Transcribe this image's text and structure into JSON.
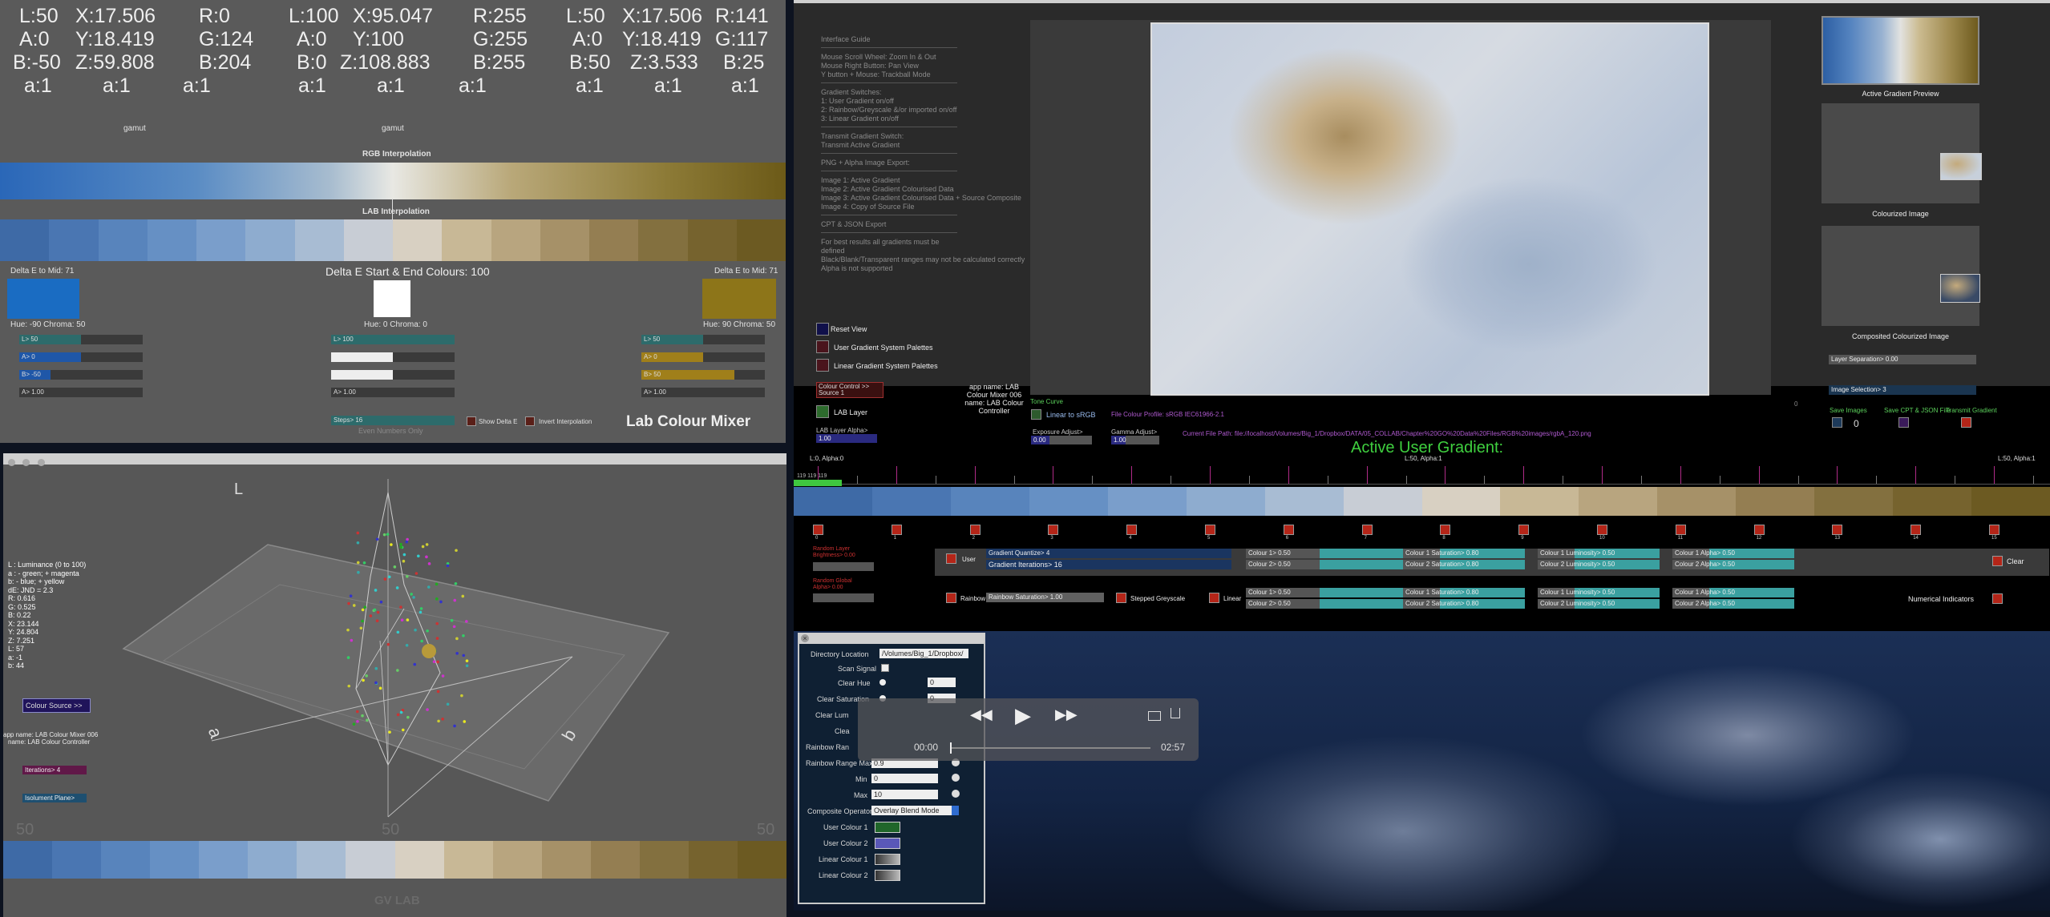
{
  "mixer": {
    "readouts": [
      {
        "rows": [
          [
            "L:50",
            "X:17.506",
            "R:0"
          ],
          [
            "A:0",
            "Y:18.419",
            "G:124"
          ],
          [
            "B:-50",
            "Z:59.808",
            "B:204"
          ],
          [
            "a:1",
            "a:1",
            "a:1"
          ]
        ]
      },
      {
        "rows": [
          [
            "L:100",
            "X:95.047",
            "R:255"
          ],
          [
            "A:0",
            "Y:100",
            "G:255"
          ],
          [
            "B:0",
            "Z:108.883",
            "B:255"
          ],
          [
            "a:1",
            "a:1",
            "a:1"
          ]
        ]
      },
      {
        "rows": [
          [
            "L:50",
            "X:17.506",
            "R:141"
          ],
          [
            "A:0",
            "Y:18.419",
            "G:117"
          ],
          [
            "B:50",
            "Z:3.533",
            "B:25"
          ],
          [
            "a:1",
            "a:1",
            "a:1"
          ]
        ]
      }
    ],
    "gamut_left": "gamut",
    "gamut_mid": "gamut",
    "rgb_label": "RGB Interpolation",
    "lab_label": "LAB Interpolation",
    "delta_left": "Delta E to Mid: 71",
    "delta_title": "Delta E Start & End Colours: 100",
    "delta_right": "Delta E to Mid: 71",
    "hue_left": "Hue: -90 Chroma: 50",
    "hue_mid": "Hue: 0 Chroma: 0",
    "hue_right": "Hue: 90 Chroma: 50",
    "sliders_left": [
      {
        "label": "L> 50",
        "value": 0.5
      },
      {
        "label": "A> 0",
        "value": 0.5
      },
      {
        "label": "B> -50",
        "value": 0.25
      },
      {
        "label": "A> 1.00",
        "value": 1.0
      }
    ],
    "sliders_mid": [
      {
        "label": "L> 100",
        "value": 1.0
      },
      {
        "label": "",
        "value": 0.5
      },
      {
        "label": "",
        "value": 0.5
      },
      {
        "label": "A> 1.00",
        "value": 1.0
      }
    ],
    "sliders_right": [
      {
        "label": "L> 50",
        "value": 0.5
      },
      {
        "label": "A> 0",
        "value": 0.5
      },
      {
        "label": "B> 50",
        "value": 0.75
      },
      {
        "label": "A> 1.00",
        "value": 1.0
      }
    ],
    "steps": "Steps> 16",
    "even_numbers": "Even Numbers Only",
    "show_delta": "Show Delta E",
    "invert_interp": "Invert Interpolation",
    "title": "Lab Colour Mixer",
    "colors": {
      "start": "#007ccc",
      "mid": "#ffffff",
      "end": "#8d7519"
    }
  },
  "gradient16": [
    "#3e6aa6",
    "#4a76b2",
    "#5884bc",
    "#6690c4",
    "#7a9ecb",
    "#8eaccf",
    "#a8bcd3",
    "#c8cdd5",
    "#d8d0c2",
    "#c8b896",
    "#b8a57f",
    "#a69168",
    "#947e52",
    "#83703f",
    "#76632e",
    "#6c5a22"
  ],
  "rgbgrad": [
    "#2a67b8",
    "#5a8cc4",
    "#a7bccf",
    "#e8e8e3",
    "#b9a879",
    "#8c7a36",
    "#6c5a18"
  ],
  "viewer": {
    "info": [
      "L : Luminance (0 to 100)",
      "a : - green; + magenta",
      "b: - blue; + yellow",
      "dE: JND = 2.3",
      "R: 0.616",
      "G: 0.525",
      "B: 0.22",
      "X: 23.144",
      "Y: 24.804",
      "Z: 7.251",
      "L: 57",
      "a: -1",
      "b: 44"
    ],
    "colour_source": "Colour Source >>",
    "app_name": "app name: LAB Colour Mixer 006",
    "app_name2": "name: LAB Colour Controller",
    "axis_l": "L",
    "axis_a": "a",
    "axis_b": "b",
    "slider1": "Iterations> 4",
    "slider2": "Isolument Plane> 0.00",
    "num_left": "50",
    "num_mid": "50",
    "num_right": "50",
    "footer": "GV LAB"
  },
  "guide": {
    "title": "Interface Guide",
    "lines1": [
      "Mouse Scroll Wheel: Zoom In & Out",
      "Mouse Right Button: Pan View",
      "Y button + Mouse: Trackball Mode"
    ],
    "title2": "Gradient Switches:",
    "lines2": [
      "1: User Gradient on/off",
      "2: Rainbow/Greyscale &/or imported on/off",
      "3: Linear Gradient on/off"
    ],
    "title3": "Transmit Gradient Switch:",
    "lines3": [
      "Transmit Active Gradient"
    ],
    "title4": "PNG + Alpha Image Export:",
    "lines4": [
      "Image 1: Active Gradient",
      "Image 2: Active Gradient Colourised Data",
      "Image 3: Active Gradient Colourised Data + Source Composite",
      "Image 4: Copy of Source File"
    ],
    "title5": "CPT & JSON Export",
    "lines5": [
      "For best results all gradients must be defined",
      "Black/Blank/Transparent ranges may not be calculated correctly",
      "Alpha is not supported"
    ]
  },
  "left_controls": {
    "reset": "Reset View",
    "user_palettes": "User Gradient System Palettes",
    "linear_palettes": "Linear Gradient System Palettes",
    "colour_control": "Colour Control >> Source 1",
    "lab_layer": "LAB Layer",
    "lab_alpha": "LAB Layer Alpha>",
    "lab_alpha_val": "1.00",
    "app_name": "app name: LAB Colour Mixer 006",
    "app_name2": "name: LAB Colour Controller",
    "tone_curve": "Tone Curve",
    "linear_srgb": "Linear to sRGB",
    "profile": "File Colour Profile: sRGB IEC61966-2.1",
    "exposure": "Exposure Adjust>",
    "exposure_val": "0.00",
    "gamma": "Gamma Adjust>",
    "gamma_val": "1.00",
    "file_path": "Current File Path: file://localhost/Volumes/Big_1/Dropbox/DATA/05_COLLAB/Chapter%20GO%20Data%20Files/RGB%20images/rgbA_120.png",
    "zero": "0"
  },
  "right_col": {
    "preview_label": "Active Gradient Preview",
    "colourized_label": "Colourized Image",
    "composited_label": "Composited Colourized Image",
    "layer_sep": "Layer Separation> 0.00",
    "image_sel": "Image Selection> 3",
    "save_images": "Save Images",
    "save_cpt": "Save CPT & JSON File",
    "transmit": "Transmit Gradient",
    "save_count": "0"
  },
  "gradient_editor": {
    "title": "Active User Gradient:",
    "left_label": "L:0, Alpha:0",
    "mid_label": "L:50, Alpha:1",
    "right_label": "L:50, Alpha:1",
    "rgb_readout": "119 119 119",
    "ticks": [
      "0",
      "1",
      "2",
      "3",
      "4",
      "5",
      "6",
      "7",
      "8",
      "9",
      "10",
      "11",
      "12",
      "13",
      "14",
      "15"
    ],
    "random_layer": "Random Layer Brightness> 0.00",
    "random_global": "Random Global Alpha> 0.00",
    "user": "User",
    "gradient_quantize": "Gradient Quantize> 4",
    "gradient_iterations": "Gradient Iterations> 16",
    "rainbow": "Rainbow",
    "rainbow_sat": "Rainbow Saturation> 1.00",
    "stepped_grey": "Stepped Greyscale",
    "linear": "Linear",
    "user_rows": [
      [
        "Colour 1> 0.50",
        "Colour 1 Saturation> 0.80",
        "Colour 1 Luminosity> 0.50",
        "Colour 1 Alpha> 0.50"
      ],
      [
        "Colour 2> 0.50",
        "Colour 2 Saturation> 0.80",
        "Colour 2 Luminosity> 0.50",
        "Colour 2 Alpha> 0.50"
      ]
    ],
    "linear_rows": [
      [
        "Colour 1> 0.50",
        "Colour 1 Saturation> 0.80",
        "Colour 1 Luminosity> 0.50",
        "Colour 1 Alpha> 0.50"
      ],
      [
        "Colour 2> 0.50",
        "Colour 2 Saturation> 0.80",
        "Colour 2 Luminosity> 0.50",
        "Colour 2 Alpha> 0.50"
      ]
    ],
    "clear": "Clear",
    "numerical": "Numerical Indicators"
  },
  "panel": {
    "dir_label": "Directory Location",
    "dir_value": "/Volumes/Big_1/Dropbox/",
    "scan": "Scan Signal",
    "clear_hue": "Clear Hue",
    "clear_hue_val": "0",
    "clear_sat": "Clear Saturation",
    "clear_sat_val": "0",
    "clear_lum": "Clear Lum",
    "clear_x": "Clea",
    "rainbow_range": "Rainbow Ran",
    "rainbow_range_max": "Rainbow Range Max",
    "rainbow_max_val": "0.9",
    "min": "Min",
    "min_val": "0",
    "max": "Max",
    "max_val": "10",
    "composite": "Composite Operator",
    "composite_val": "Overlay Blend Mode",
    "user1": "User Colour 1",
    "user2": "User Colour 2",
    "lin1": "Linear Colour 1",
    "lin2": "Linear Colour 2"
  },
  "player": {
    "time_current": "00:00",
    "time_total": "02:57"
  }
}
